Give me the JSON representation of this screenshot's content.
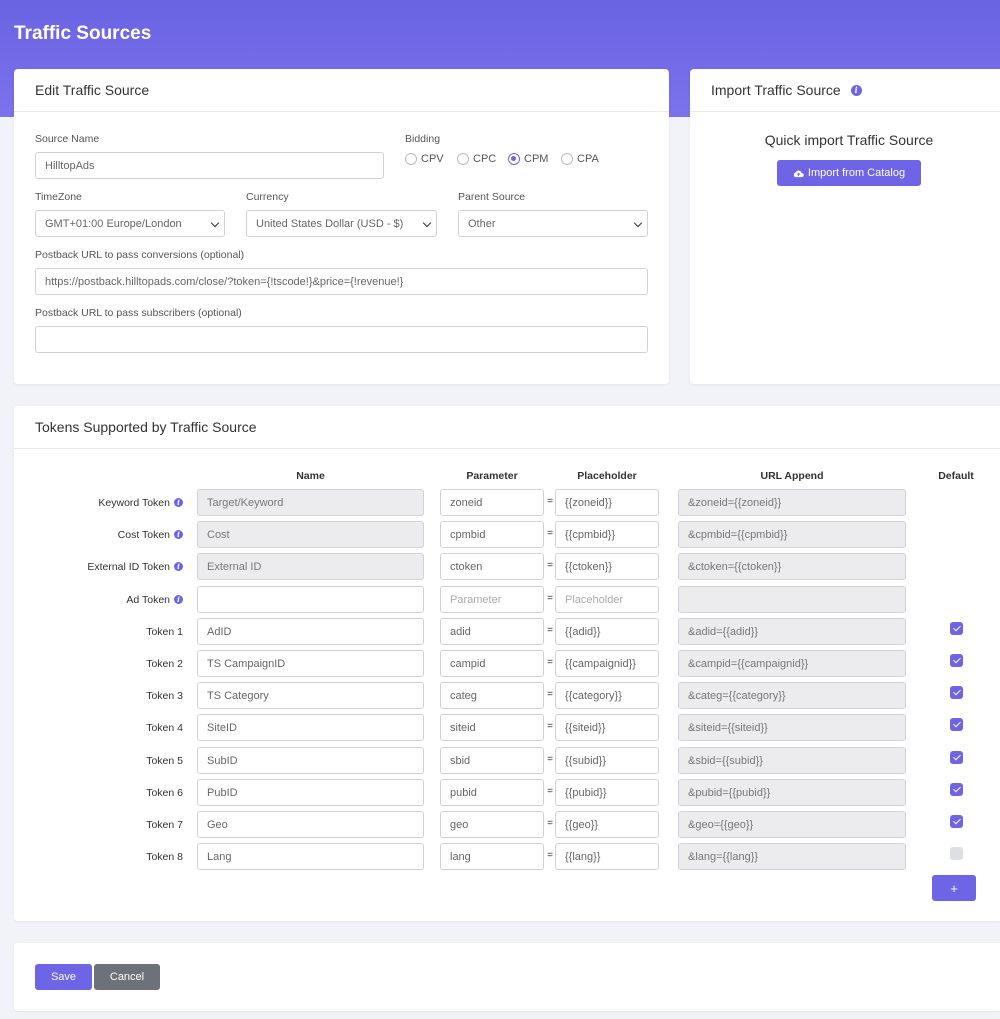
{
  "page": {
    "title": "Traffic Sources"
  },
  "edit": {
    "header": "Edit Traffic Source",
    "source_name_label": "Source Name",
    "source_name_value": "HilltopAds",
    "bidding_label": "Bidding",
    "bidding_options": [
      "CPV",
      "CPC",
      "CPM",
      "CPA"
    ],
    "bidding_selected": "CPM",
    "timezone_label": "TimeZone",
    "timezone_value": "GMT+01:00 Europe/London",
    "currency_label": "Currency",
    "currency_value": "United States Dollar (USD - $)",
    "parent_label": "Parent Source",
    "parent_value": "Other",
    "postback_conv_label": "Postback URL to pass conversions (optional)",
    "postback_conv_value": "https://postback.hilltopads.com/close/?token={!tscode!}&price={!revenue!}",
    "postback_sub_label": "Postback URL to pass subscribers (optional)",
    "postback_sub_value": ""
  },
  "import": {
    "header": "Import Traffic Source",
    "quick_title": "Quick import Traffic Source",
    "button_label": "Import from Catalog"
  },
  "tokens": {
    "header": "Tokens Supported by Traffic Source",
    "columns": {
      "name": "Name",
      "parameter": "Parameter",
      "placeholder": "Placeholder",
      "url_append": "URL Append",
      "default": "Default"
    },
    "rows": [
      {
        "label": "Keyword Token",
        "info": true,
        "name": "Target/Keyword",
        "name_gray": true,
        "parameter": "zoneid",
        "placeholder": "{{zoneid}}",
        "url": "&zoneid={{zoneid}}",
        "default": null
      },
      {
        "label": "Cost Token",
        "info": true,
        "name": "Cost",
        "name_gray": true,
        "parameter": "cpmbid",
        "placeholder": "{{cpmbid}}",
        "url": "&cpmbid={{cpmbid}}",
        "default": null
      },
      {
        "label": "External ID Token",
        "info": true,
        "name": "External ID",
        "name_gray": true,
        "parameter": "ctoken",
        "placeholder": "{{ctoken}}",
        "url": "&ctoken={{ctoken}}",
        "default": null
      },
      {
        "label": "Ad Token",
        "info": true,
        "name": "",
        "name_gray": false,
        "parameter": "",
        "parameter_ph": "Parameter",
        "placeholder": "",
        "placeholder_ph": "Placeholder",
        "url": "",
        "default": null
      },
      {
        "label": "Token 1",
        "info": false,
        "name": "AdID",
        "name_gray": false,
        "parameter": "adid",
        "placeholder": "{{adid}}",
        "url": "&adid={{adid}}",
        "default": true
      },
      {
        "label": "Token 2",
        "info": false,
        "name": "TS CampaignID",
        "name_gray": false,
        "parameter": "campid",
        "placeholder": "{{campaignid}}",
        "url": "&campid={{campaignid}}",
        "default": true
      },
      {
        "label": "Token 3",
        "info": false,
        "name": "TS Category",
        "name_gray": false,
        "parameter": "categ",
        "placeholder": "{{category}}",
        "url": "&categ={{category}}",
        "default": true
      },
      {
        "label": "Token 4",
        "info": false,
        "name": "SiteID",
        "name_gray": false,
        "parameter": "siteid",
        "placeholder": "{{siteid}}",
        "url": "&siteid={{siteid}}",
        "default": true
      },
      {
        "label": "Token 5",
        "info": false,
        "name": "SubID",
        "name_gray": false,
        "parameter": "sbid",
        "placeholder": "{{subid}}",
        "url": "&sbid={{subid}}",
        "default": true
      },
      {
        "label": "Token 6",
        "info": false,
        "name": "PubID",
        "name_gray": false,
        "parameter": "pubid",
        "placeholder": "{{pubid}}",
        "url": "&pubid={{pubid}}",
        "default": true
      },
      {
        "label": "Token 7",
        "info": false,
        "name": "Geo",
        "name_gray": false,
        "parameter": "geo",
        "placeholder": "{{geo}}",
        "url": "&geo={{geo}}",
        "default": true
      },
      {
        "label": "Token 8",
        "info": false,
        "name": "Lang",
        "name_gray": false,
        "parameter": "lang",
        "placeholder": "{{lang}}",
        "url": "&lang={{lang}}",
        "default": false
      }
    ],
    "add_label": "+"
  },
  "actions": {
    "save_label": "Save",
    "cancel_label": "Cancel"
  },
  "colors": {
    "accent": "#6d65e6",
    "header_bg": "#6a63e2",
    "secondary": "#6c7277"
  },
  "icons": {
    "info": "info-icon",
    "cloud_upload": "cloud-upload-icon",
    "dropdown": "chevron-down-icon"
  }
}
